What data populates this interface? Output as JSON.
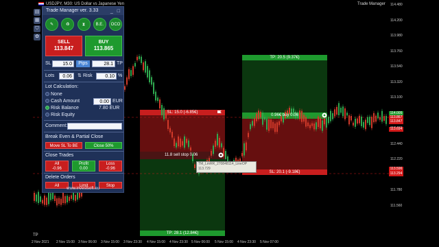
{
  "chart_title": "USDJPY, M30:  US Dollar vs Japanese Yen",
  "ea_label": "Trade Manager",
  "tp_left_label": "TP",
  "panel": {
    "title": "Trade Manager ver. 3.33",
    "title_buttons": "_ □",
    "icon_buttons": [
      {
        "name": "pencil-icon",
        "glyph": "✎"
      },
      {
        "name": "recycle-icon",
        "glyph": "♻"
      },
      {
        "name": "hourglass-icon",
        "glyph": "⧗"
      },
      {
        "name": "breakeven-icon",
        "glyph": "B.E."
      },
      {
        "name": "oco-icon",
        "glyph": "OCO"
      }
    ],
    "sell": {
      "label": "SELL",
      "price": "113.847"
    },
    "buy": {
      "label": "BUY",
      "price": "113.865"
    },
    "sl_label": "SL",
    "sl_value": "15.0",
    "pips_label": "Pips",
    "tp_value": "28.1",
    "tp_label": "TP",
    "lots_label": "Lots",
    "lots_value": "0.06",
    "risk_label": "Risk",
    "risk_value": "0.10",
    "risk_unit": "%",
    "lot_calc_header": "Lot Calculation:",
    "lot_calc_options": [
      {
        "label": "None",
        "selected": false
      },
      {
        "label": "Cash Amount",
        "selected": false
      },
      {
        "label": "Risk Balance",
        "selected": true
      },
      {
        "label": "Risk Equity",
        "selected": false
      }
    ],
    "cash_value": "0.00",
    "cash_unit": "EUR",
    "risk_balance_value": "7.80 EUR",
    "comment_label": "Comment:",
    "be_header": "Break Even & Partial Close",
    "move_sl_label": "Move SL To BE",
    "close50_label": "Close 50%",
    "close_trades_header": "Close Trades",
    "close_all": {
      "label": "All",
      "value": "-0.96"
    },
    "close_profit": {
      "label": "Profit",
      "value": "0.00"
    },
    "close_loss": {
      "label": "Loss",
      "value": "-0.96"
    },
    "delete_orders_header": "Delete Orders",
    "del_all_label": "All",
    "del_limit_label": "Limit",
    "del_stop_label": "Stop",
    "footer_url": "www.investsoft.eu"
  },
  "zones": {
    "sl_top": "SL: 15.0 (-6.85€)",
    "sell_stop": "11.8 sell stop 0.06",
    "tp_bottom": "TP: 28.1 (12.84€)",
    "tp_right": "TP: 20.5 (9.37€)",
    "buy_line": "0.96€ buy 0.06",
    "sl_right": "SL: 20.1 (-9.18€)"
  },
  "tooltip": {
    "line1": "TM_LmRR_270848114_LineOP",
    "line2": "113.729"
  },
  "y_axis": [
    "114.480",
    "114.200",
    "113.980",
    "113.760",
    "113.540",
    "113.320",
    "113.100",
    "112.880",
    "112.660",
    "112.440",
    "112.220",
    "112.000",
    "111.780",
    "111.560"
  ],
  "price_tags": [
    {
      "text": "114.005",
      "color": "#1e9a2e"
    },
    {
      "text": "113.867",
      "color": "#d21a1a"
    },
    {
      "text": "113.847",
      "color": "#d21a1a"
    },
    {
      "text": "113.694",
      "color": "#d21a1a"
    },
    {
      "text": "113.596",
      "color": "#d21a1a"
    },
    {
      "text": "113.294",
      "color": "#d21a1a"
    }
  ],
  "x_axis": [
    "2 Nov 2021",
    "2 Nov 15:00",
    "3 Nov 06:00",
    "3 Nov 15:00",
    "3 Nov 23:30",
    "4 Nov 15:00",
    "4 Nov 23:30",
    "5 Nov 06:00",
    "5 Nov 15:00",
    "4 Nov 23:30",
    "5 Nov 07:00"
  ],
  "colors": {
    "sell_red": "#c81e1e",
    "buy_green": "#1e9a2e",
    "panel_bg": "#1f3158"
  }
}
